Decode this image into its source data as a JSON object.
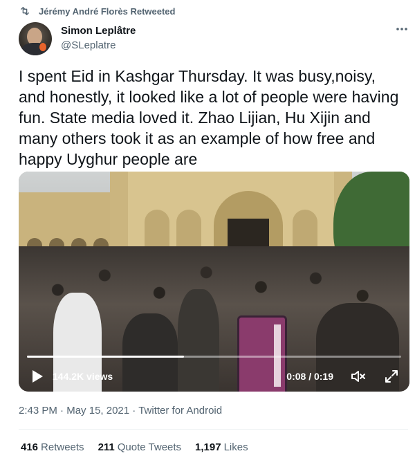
{
  "retweet": {
    "text": "Jérémy André Florès Retweeted",
    "icon": "retweet-icon"
  },
  "author": {
    "name": "Simon Leplâtre",
    "handle": "@SLeplatre",
    "avatar_icon": "avatar-photo"
  },
  "more_icon": "more-horizontal-icon",
  "tweet": {
    "text": "I spent Eid in Kashgar Thursday. It was busy,noisy, and honestly, it looked like a lot of people were having fun. State media loved it. Zhao Lijian, Hu Xijin and many others took it as an example of how free and happy Uyghur people are"
  },
  "video": {
    "views": "144.2K views",
    "time": "0:08 / 0:19",
    "progress": 0.42,
    "icons": {
      "play": "play-icon",
      "mute": "mute-icon",
      "fullscreen": "fullscreen-icon"
    }
  },
  "meta": {
    "time": "2:43 PM",
    "date": "May 15, 2021",
    "separator": "·",
    "source": "Twitter for Android"
  },
  "stats": {
    "retweets_count": "416",
    "retweets_label": "Retweets",
    "quotes_count": "211",
    "quotes_label": "Quote Tweets",
    "likes_count": "1,197",
    "likes_label": "Likes"
  },
  "colors": {
    "primary_text": "#0f1419",
    "secondary_text": "#536471",
    "divider": "#eff3f4"
  }
}
